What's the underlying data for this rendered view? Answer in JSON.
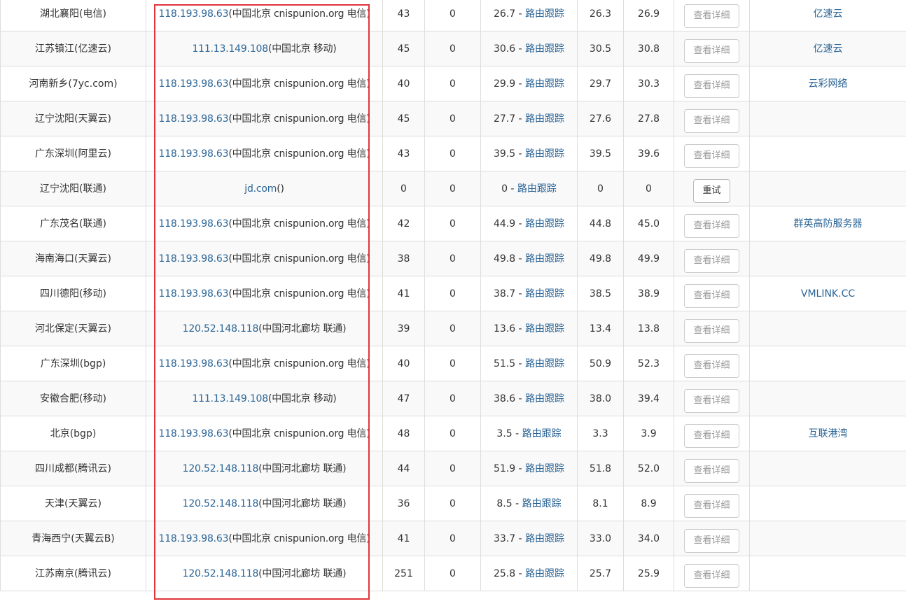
{
  "trace_label": "路由跟踪",
  "rows": [
    {
      "node": "湖北襄阳(电信)",
      "ip": "118.193.98.63",
      "loc": "(中国北京 cnispunion.org 电信)",
      "ttl": "43",
      "loss": "0",
      "avg": "26.7",
      "min": "26.3",
      "max": "26.9",
      "btn": "查看详细",
      "btn_active": false,
      "sponsor": "亿速云"
    },
    {
      "node": "江苏镇江(亿速云)",
      "ip": "111.13.149.108",
      "loc": "(中国北京 移动)",
      "ttl": "45",
      "loss": "0",
      "avg": "30.6",
      "min": "30.5",
      "max": "30.8",
      "btn": "查看详细",
      "btn_active": false,
      "sponsor": "亿速云"
    },
    {
      "node": "河南新乡(7yc.com)",
      "ip": "118.193.98.63",
      "loc": "(中国北京 cnispunion.org 电信)",
      "ttl": "40",
      "loss": "0",
      "avg": "29.9",
      "min": "29.7",
      "max": "30.3",
      "btn": "查看详细",
      "btn_active": false,
      "sponsor": "云彩网络"
    },
    {
      "node": "辽宁沈阳(天翼云)",
      "ip": "118.193.98.63",
      "loc": "(中国北京 cnispunion.org 电信)",
      "ttl": "45",
      "loss": "0",
      "avg": "27.7",
      "min": "27.6",
      "max": "27.8",
      "btn": "查看详细",
      "btn_active": false,
      "sponsor": ""
    },
    {
      "node": "广东深圳(阿里云)",
      "ip": "118.193.98.63",
      "loc": "(中国北京 cnispunion.org 电信)",
      "ttl": "43",
      "loss": "0",
      "avg": "39.5",
      "min": "39.5",
      "max": "39.6",
      "btn": "查看详细",
      "btn_active": false,
      "sponsor": ""
    },
    {
      "node": "辽宁沈阳(联通)",
      "ip": "jd.com",
      "loc": "()",
      "ttl": "0",
      "loss": "0",
      "avg": "0",
      "min": "0",
      "max": "0",
      "btn": "重试",
      "btn_active": true,
      "sponsor": ""
    },
    {
      "node": "广东茂名(联通)",
      "ip": "118.193.98.63",
      "loc": "(中国北京 cnispunion.org 电信)",
      "ttl": "42",
      "loss": "0",
      "avg": "44.9",
      "min": "44.8",
      "max": "45.0",
      "btn": "查看详细",
      "btn_active": false,
      "sponsor": "群英高防服务器"
    },
    {
      "node": "海南海口(天翼云)",
      "ip": "118.193.98.63",
      "loc": "(中国北京 cnispunion.org 电信)",
      "ttl": "38",
      "loss": "0",
      "avg": "49.8",
      "min": "49.8",
      "max": "49.9",
      "btn": "查看详细",
      "btn_active": false,
      "sponsor": ""
    },
    {
      "node": "四川德阳(移动)",
      "ip": "118.193.98.63",
      "loc": "(中国北京 cnispunion.org 电信)",
      "ttl": "41",
      "loss": "0",
      "avg": "38.7",
      "min": "38.5",
      "max": "38.9",
      "btn": "查看详细",
      "btn_active": false,
      "sponsor": "VMLINK.CC"
    },
    {
      "node": "河北保定(天翼云)",
      "ip": "120.52.148.118",
      "loc": "(中国河北廊坊 联通)",
      "ttl": "39",
      "loss": "0",
      "avg": "13.6",
      "min": "13.4",
      "max": "13.8",
      "btn": "查看详细",
      "btn_active": false,
      "sponsor": ""
    },
    {
      "node": "广东深圳(bgp)",
      "ip": "118.193.98.63",
      "loc": "(中国北京 cnispunion.org 电信)",
      "ttl": "40",
      "loss": "0",
      "avg": "51.5",
      "min": "50.9",
      "max": "52.3",
      "btn": "查看详细",
      "btn_active": false,
      "sponsor": ""
    },
    {
      "node": "安徽合肥(移动)",
      "ip": "111.13.149.108",
      "loc": "(中国北京 移动)",
      "ttl": "47",
      "loss": "0",
      "avg": "38.6",
      "min": "38.0",
      "max": "39.4",
      "btn": "查看详细",
      "btn_active": false,
      "sponsor": ""
    },
    {
      "node": "北京(bgp)",
      "ip": "118.193.98.63",
      "loc": "(中国北京 cnispunion.org 电信)",
      "ttl": "48",
      "loss": "0",
      "avg": "3.5",
      "min": "3.3",
      "max": "3.9",
      "btn": "查看详细",
      "btn_active": false,
      "sponsor": "互联港湾"
    },
    {
      "node": "四川成都(腾讯云)",
      "ip": "120.52.148.118",
      "loc": "(中国河北廊坊 联通)",
      "ttl": "44",
      "loss": "0",
      "avg": "51.9",
      "min": "51.8",
      "max": "52.0",
      "btn": "查看详细",
      "btn_active": false,
      "sponsor": ""
    },
    {
      "node": "天津(天翼云)",
      "ip": "120.52.148.118",
      "loc": "(中国河北廊坊 联通)",
      "ttl": "36",
      "loss": "0",
      "avg": "8.5",
      "min": "8.1",
      "max": "8.9",
      "btn": "查看详细",
      "btn_active": false,
      "sponsor": ""
    },
    {
      "node": "青海西宁(天翼云B)",
      "ip": "118.193.98.63",
      "loc": "(中国北京 cnispunion.org 电信)",
      "ttl": "41",
      "loss": "0",
      "avg": "33.7",
      "min": "33.0",
      "max": "34.0",
      "btn": "查看详细",
      "btn_active": false,
      "sponsor": ""
    },
    {
      "node": "江苏南京(腾讯云)",
      "ip": "120.52.148.118",
      "loc": "(中国河北廊坊 联通)",
      "ttl": "251",
      "loss": "0",
      "avg": "25.8",
      "min": "25.7",
      "max": "25.9",
      "btn": "查看详细",
      "btn_active": false,
      "sponsor": ""
    }
  ]
}
